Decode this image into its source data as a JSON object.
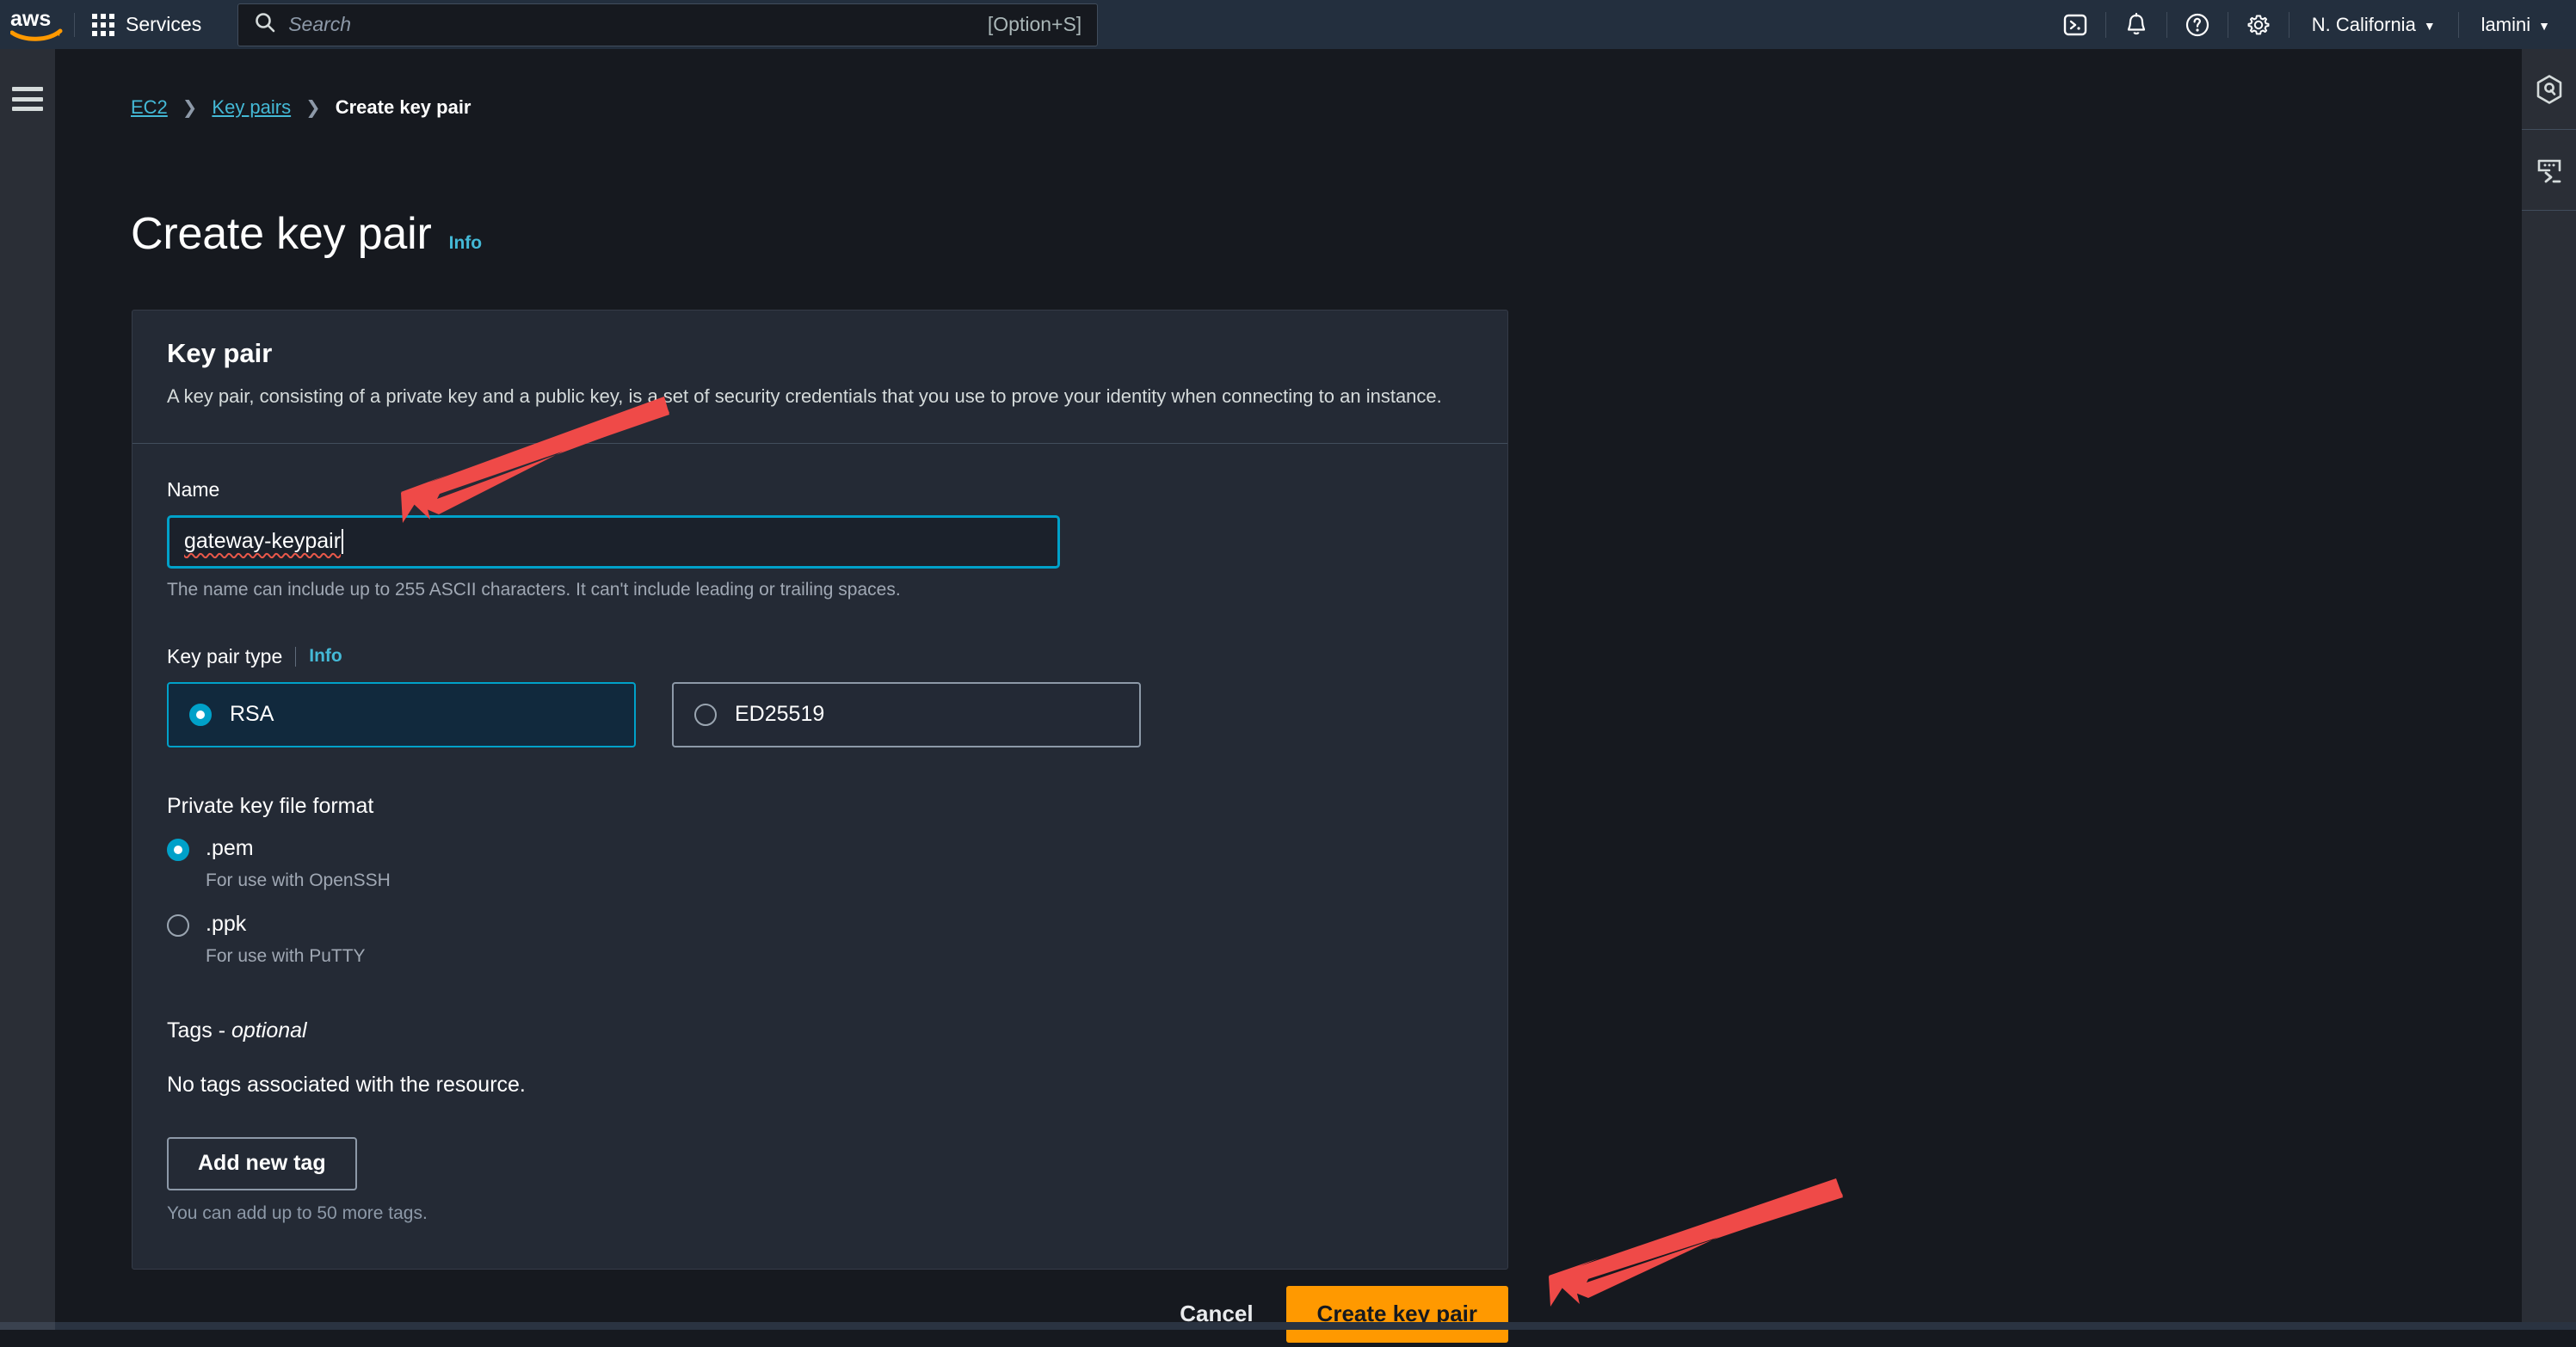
{
  "top_nav": {
    "logo_alt": "aws",
    "services_label": "Services",
    "search": {
      "placeholder": "Search",
      "shortcut": "[Option+S]"
    },
    "icons": [
      "cloudshell-icon",
      "notifications-bell-icon",
      "help-question-icon",
      "settings-gear-icon"
    ],
    "region": "N. California",
    "account": "lamini",
    "caret_glyph": "▼"
  },
  "breadcrumb": {
    "items": [
      {
        "label": "EC2",
        "is_link": true
      },
      {
        "label": "Key pairs",
        "is_link": true
      },
      {
        "label": "Create key pair",
        "is_link": false
      }
    ],
    "separator": "❯"
  },
  "page": {
    "title": "Create key pair",
    "info_label": "Info"
  },
  "card": {
    "title": "Key pair",
    "description": "A key pair, consisting of a private key and a public key, is a set of security credentials that you use to prove your identity when connecting to an instance.",
    "name_field": {
      "label": "Name",
      "value": "gateway-keypair",
      "help": "The name can include up to 255 ASCII characters. It can't include leading or trailing spaces."
    },
    "key_pair_type": {
      "label": "Key pair type",
      "info_label": "Info",
      "options": [
        {
          "label": "RSA",
          "selected": true
        },
        {
          "label": "ED25519",
          "selected": false
        }
      ]
    },
    "private_key_format": {
      "label": "Private key file format",
      "options": [
        {
          "label": ".pem",
          "sub": "For use with OpenSSH",
          "selected": true
        },
        {
          "label": ".ppk",
          "sub": "For use with PuTTY",
          "selected": false
        }
      ]
    },
    "tags": {
      "label": "Tags - ",
      "label_em": "optional",
      "empty": "No tags associated with the resource.",
      "add_button": "Add new tag",
      "note": "You can add up to 50 more tags."
    }
  },
  "actions": {
    "cancel": "Cancel",
    "create": "Create key pair"
  },
  "right_rail": {
    "icons": [
      "amazon-q-hex-icon",
      "cloudshell-terminal-icon"
    ]
  },
  "colors": {
    "nav_background": "#232f3e",
    "page_background": "#16191f",
    "card_background": "#242a35",
    "accent_link": "#44b9d6",
    "focus_ring": "#00a1c9",
    "primary_button": "#ff9900",
    "annotation_arrow": "#ef4a48"
  }
}
